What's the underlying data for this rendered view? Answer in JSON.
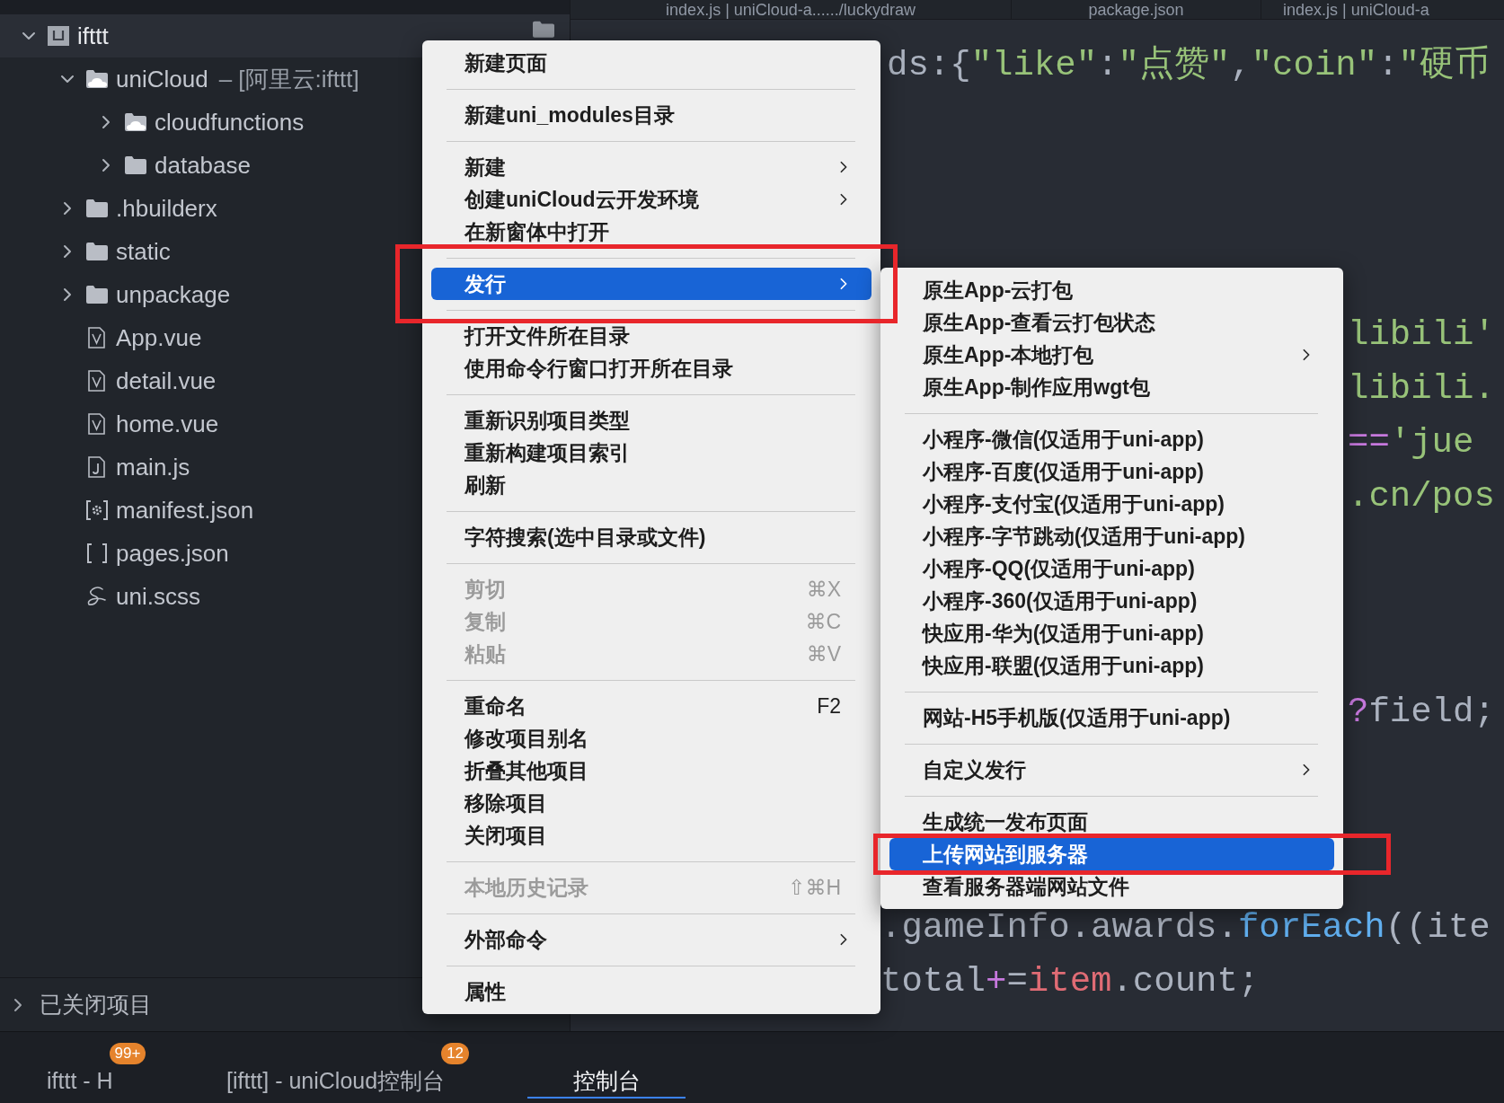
{
  "sidebar": {
    "tree": [
      {
        "label": "ifttt",
        "kind": "project",
        "expanded": true,
        "selected": true,
        "children": [
          {
            "label": "uniCloud",
            "note": "– [阿里云:ifttt]",
            "kind": "cloud-folder",
            "expanded": true,
            "selected": false,
            "children": [
              {
                "label": "cloudfunctions",
                "kind": "cloud-folder",
                "expanded": false,
                "selected": false
              },
              {
                "label": "database",
                "kind": "folder",
                "expanded": false,
                "selected": false
              }
            ]
          },
          {
            "label": ".hbuilderx",
            "kind": "folder",
            "expanded": false,
            "selected": false
          },
          {
            "label": "static",
            "kind": "folder",
            "expanded": false,
            "selected": false
          },
          {
            "label": "unpackage",
            "kind": "folder",
            "expanded": false,
            "selected": false
          },
          {
            "label": "App.vue",
            "kind": "vue",
            "selected": false
          },
          {
            "label": "detail.vue",
            "kind": "vue",
            "selected": false
          },
          {
            "label": "home.vue",
            "kind": "vue",
            "selected": false
          },
          {
            "label": "main.js",
            "kind": "js",
            "selected": false
          },
          {
            "label": "manifest.json",
            "kind": "manifest",
            "selected": false
          },
          {
            "label": "pages.json",
            "kind": "json",
            "selected": false
          },
          {
            "label": "uni.scss",
            "kind": "scss",
            "selected": false
          }
        ]
      }
    ],
    "closed_projects": {
      "label": "已关闭项目",
      "expanded": false
    }
  },
  "editor": {
    "tabs": [
      {
        "label": "index.js | uniCloud-a....../luckydraw"
      },
      {
        "label": "package.json"
      },
      {
        "label": "index.js | uniCloud-a"
      }
    ],
    "code_lines": [
      {
        "segments": [
          {
            "text": "ds:{",
            "kind": "plain"
          },
          {
            "text": "\"like\"",
            "kind": "string"
          },
          {
            "text": ":",
            "kind": "plain"
          },
          {
            "text": "\"点赞\"",
            "kind": "string"
          },
          {
            "text": ",",
            "kind": "plain"
          },
          {
            "text": "\"coin\"",
            "kind": "string"
          },
          {
            "text": ":",
            "kind": "plain"
          },
          {
            "text": "\"硬币",
            "kind": "string"
          }
        ]
      },
      {
        "segments": [
          {
            "text": "libili'",
            "kind": "string"
          }
        ]
      },
      {
        "segments": [
          {
            "text": "libili.",
            "kind": "string"
          }
        ]
      },
      {
        "segments": [
          {
            "text": "==",
            "kind": "operator"
          },
          {
            "text": "'jue",
            "kind": "string"
          }
        ]
      },
      {
        "segments": [
          {
            "text": ".cn/pos",
            "kind": "string"
          }
        ]
      },
      {
        "segments": [
          {
            "text": "?",
            "kind": "operator"
          },
          {
            "text": "field;",
            "kind": "plain"
          }
        ]
      },
      {
        "segments": [
          {
            "text": ".gameInfo.awards.",
            "kind": "plain"
          },
          {
            "text": "forEach",
            "kind": "function"
          },
          {
            "text": "((ite",
            "kind": "plain"
          }
        ]
      },
      {
        "segments": [
          {
            "text": "total",
            "kind": "plain"
          },
          {
            "text": "+",
            "kind": "operator"
          },
          {
            "text": "=",
            "kind": "plain"
          },
          {
            "text": "item",
            "kind": "variable"
          },
          {
            "text": ".count;",
            "kind": "plain"
          }
        ]
      }
    ]
  },
  "context_menu": {
    "groups": [
      [
        {
          "label": "新建页面",
          "submenu": false,
          "disabled": false,
          "selected": false
        }
      ],
      [
        {
          "label": "新建uni_modules目录",
          "submenu": false,
          "disabled": false,
          "selected": false
        }
      ],
      [
        {
          "label": "新建",
          "submenu": true,
          "disabled": false,
          "selected": false
        },
        {
          "label": "创建uniCloud云开发环境",
          "submenu": true,
          "disabled": false,
          "selected": false
        },
        {
          "label": "在新窗体中打开",
          "submenu": false,
          "disabled": false,
          "selected": false
        }
      ],
      [
        {
          "label": "发行",
          "submenu": true,
          "disabled": false,
          "selected": true
        }
      ],
      [
        {
          "label": "打开文件所在目录",
          "submenu": false,
          "disabled": false,
          "selected": false
        },
        {
          "label": "使用命令行窗口打开所在目录",
          "submenu": false,
          "disabled": false,
          "selected": false
        }
      ],
      [
        {
          "label": "重新识别项目类型",
          "submenu": false,
          "disabled": false,
          "selected": false
        },
        {
          "label": "重新构建项目索引",
          "submenu": false,
          "disabled": false,
          "selected": false
        },
        {
          "label": "刷新",
          "submenu": false,
          "disabled": false,
          "selected": false
        }
      ],
      [
        {
          "label": "字符搜索(选中目录或文件)",
          "submenu": false,
          "disabled": false,
          "selected": false
        }
      ],
      [
        {
          "label": "剪切",
          "shortcut": "⌘X",
          "submenu": false,
          "disabled": true,
          "selected": false
        },
        {
          "label": "复制",
          "shortcut": "⌘C",
          "submenu": false,
          "disabled": true,
          "selected": false
        },
        {
          "label": "粘贴",
          "shortcut": "⌘V",
          "submenu": false,
          "disabled": true,
          "selected": false
        }
      ],
      [
        {
          "label": "重命名",
          "shortcut": "F2",
          "submenu": false,
          "disabled": false,
          "selected": false
        },
        {
          "label": "修改项目别名",
          "submenu": false,
          "disabled": false,
          "selected": false
        },
        {
          "label": "折叠其他项目",
          "submenu": false,
          "disabled": false,
          "selected": false
        },
        {
          "label": "移除项目",
          "submenu": false,
          "disabled": false,
          "selected": false
        },
        {
          "label": "关闭项目",
          "submenu": false,
          "disabled": false,
          "selected": false
        }
      ],
      [
        {
          "label": "本地历史记录",
          "shortcut": "⇧⌘H",
          "submenu": false,
          "disabled": true,
          "selected": false
        }
      ],
      [
        {
          "label": "外部命令",
          "submenu": true,
          "disabled": false,
          "selected": false
        }
      ],
      [
        {
          "label": "属性",
          "submenu": false,
          "disabled": false,
          "selected": false
        }
      ]
    ]
  },
  "submenu": {
    "groups": [
      [
        {
          "label": "原生App-云打包",
          "submenu": false,
          "disabled": false,
          "selected": false
        },
        {
          "label": "原生App-查看云打包状态",
          "submenu": false,
          "disabled": false,
          "selected": false
        },
        {
          "label": "原生App-本地打包",
          "submenu": true,
          "disabled": false,
          "selected": false
        },
        {
          "label": "原生App-制作应用wgt包",
          "submenu": false,
          "disabled": false,
          "selected": false
        }
      ],
      [
        {
          "label": "小程序-微信(仅适用于uni-app)",
          "submenu": false,
          "disabled": false,
          "selected": false
        },
        {
          "label": "小程序-百度(仅适用于uni-app)",
          "submenu": false,
          "disabled": false,
          "selected": false
        },
        {
          "label": "小程序-支付宝(仅适用于uni-app)",
          "submenu": false,
          "disabled": false,
          "selected": false
        },
        {
          "label": "小程序-字节跳动(仅适用于uni-app)",
          "submenu": false,
          "disabled": false,
          "selected": false
        },
        {
          "label": "小程序-QQ(仅适用于uni-app)",
          "submenu": false,
          "disabled": false,
          "selected": false
        },
        {
          "label": "小程序-360(仅适用于uni-app)",
          "submenu": false,
          "disabled": false,
          "selected": false
        },
        {
          "label": "快应用-华为(仅适用于uni-app)",
          "submenu": false,
          "disabled": false,
          "selected": false
        },
        {
          "label": "快应用-联盟(仅适用于uni-app)",
          "submenu": false,
          "disabled": false,
          "selected": false
        }
      ],
      [
        {
          "label": "网站-H5手机版(仅适用于uni-app)",
          "submenu": false,
          "disabled": false,
          "selected": false
        }
      ],
      [
        {
          "label": "自定义发行",
          "submenu": true,
          "disabled": false,
          "selected": false
        }
      ],
      [
        {
          "label": "生成统一发布页面",
          "submenu": false,
          "disabled": false,
          "selected": false
        },
        {
          "label": "上传网站到服务器",
          "submenu": false,
          "disabled": false,
          "selected": true
        },
        {
          "label": "查看服务器端网站文件",
          "submenu": false,
          "disabled": false,
          "selected": false
        }
      ]
    ]
  },
  "bottom_panel": {
    "tabs": [
      {
        "label": "ifttt - H",
        "badge": "99+",
        "selected": false
      },
      {
        "label": "[ifttt] - uniCloud控制台",
        "badge": "12",
        "selected": false
      },
      {
        "label": "控制台",
        "selected": true
      }
    ]
  }
}
